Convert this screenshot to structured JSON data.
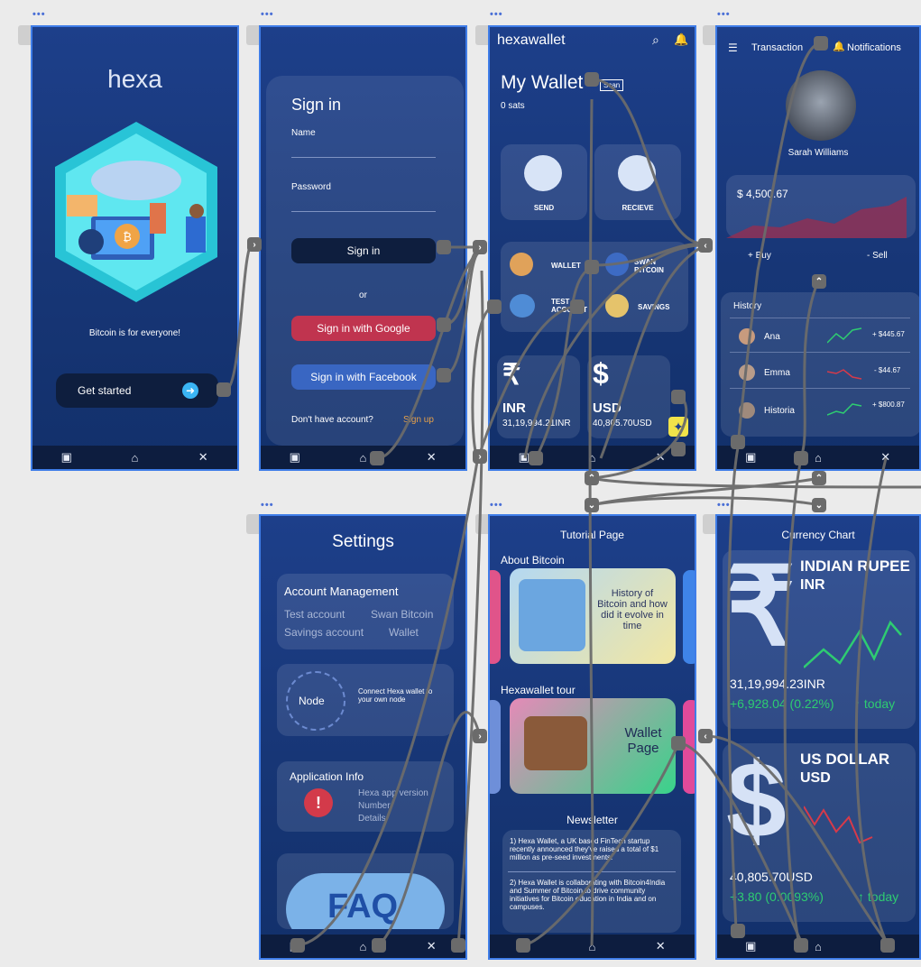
{
  "colors": {
    "screen_bg": "#173676",
    "accent_blue": "#3f7de8",
    "google_red": "#c0344f",
    "facebook_blue": "#3966c2",
    "positive_green": "#2ecc71",
    "negative_red": "#d63a4a",
    "wire_gray": "#6b6b6b"
  },
  "frame_dots": "•••",
  "nav_icons": [
    "wallet-icon",
    "home-icon",
    "tools-icon"
  ],
  "splash": {
    "brand": "hexa",
    "tagline": "Bitcoin is for everyone!",
    "cta": "Get started"
  },
  "signin": {
    "title": "Sign in",
    "name_label": "Name",
    "password_label": "Password",
    "signin_button": "Sign in",
    "or": "or",
    "google_button": "Sign in with Google",
    "facebook_button": "Sign in with Facebook",
    "no_account": "Don't have account?",
    "signup_link": "Sign up"
  },
  "wallet": {
    "app_name": "hexawallet",
    "title": "My Wallet",
    "scan_label": "Scan",
    "balance": "0 sats",
    "send": "SEND",
    "receive": "RECIEVE",
    "menu": [
      {
        "label": "WALLET"
      },
      {
        "label": "SWAN BITCOIN"
      },
      {
        "label": "TEST ACCOUNT"
      },
      {
        "label": "SAVINGS"
      }
    ],
    "currencies": [
      {
        "symbol": "₹",
        "code": "INR",
        "amount": "31,19,994.21INR"
      },
      {
        "symbol": "$",
        "code": "USD",
        "amount": "40,805.70USD"
      }
    ]
  },
  "profile": {
    "transactions": "Transaction",
    "notifications": "Notifications",
    "name": "Sarah Williams",
    "balance": "$ 4,500.67",
    "buy": "+ Buy",
    "sell": "- Sell",
    "history_title": "History",
    "history": [
      {
        "name": "Ana",
        "amount": "+ $445.67",
        "trend": "up"
      },
      {
        "name": "Emma",
        "amount": "- $44.67",
        "trend": "down"
      },
      {
        "name": "Historia",
        "amount": "+ $800.87",
        "trend": "up"
      }
    ]
  },
  "settings": {
    "title": "Settings",
    "account_title": "Account Management",
    "accounts": [
      "Test account",
      "Swan Bitcoin",
      "Savings account",
      "Wallet"
    ],
    "node_label": "Node",
    "node_text": "Connect Hexa wallet to your own node",
    "app_info_title": "Application Info",
    "app_info_lines": [
      "Hexa app version",
      "Number",
      "Details"
    ],
    "faq": "FAQ"
  },
  "tutorial": {
    "title": "Tutorial Page",
    "about_title": "About Bitcoin",
    "about_card": "History of Bitcoin and how did it evolve in time",
    "tour_title": "Hexawallet tour",
    "tour_card": "Wallet Page",
    "newsletter_title": "Newsletter",
    "news": [
      "1) Hexa Wallet, a UK based FinTech startup recently announced they've raised a total of $1 million as pre-seed investments.",
      "2) Hexa Wallet is collaborating with Bitcoin4India and Summer of Bitcoin to drive community initiatives for Bitcoin education in India and on campuses."
    ]
  },
  "currency_chart": {
    "title": "Currency Chart",
    "items": [
      {
        "symbol": "₹",
        "name": "INDIAN RUPEE",
        "code": "INR",
        "value": "31,19,994.23INR",
        "change": "+6,928.04 (0.22%)",
        "today": "↑ today"
      },
      {
        "symbol": "$",
        "name": "US DOLLAR",
        "code": "USD",
        "value": "40,805.70USD",
        "change": "+3.80 (0.0093%)",
        "today": "↑ today"
      }
    ]
  }
}
